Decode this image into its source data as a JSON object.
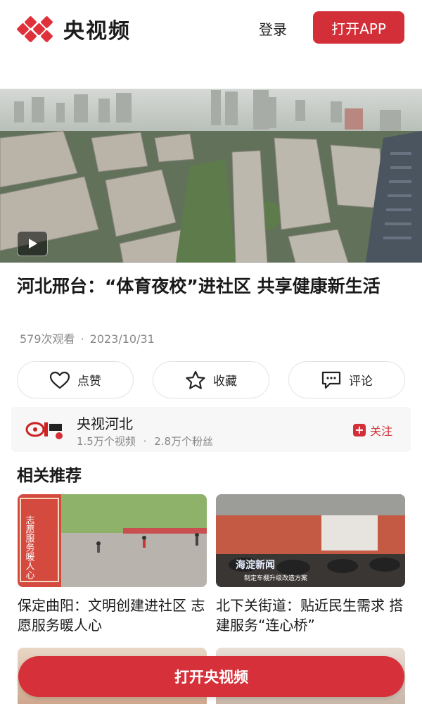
{
  "header": {
    "logo_text": "央视频",
    "login_label": "登录",
    "open_app_label": "打开APP",
    "brand_color": "#d32f38"
  },
  "video": {
    "play_icon": "play-icon"
  },
  "article": {
    "title": "河北邢台：“体育夜校”进社区 共享健康新生活",
    "views": "579次观看",
    "separator": "·",
    "date": "2023/10/31"
  },
  "actions": {
    "like_label": "点赞",
    "favorite_label": "收藏",
    "comment_label": "评论"
  },
  "channel": {
    "name": "央视河北",
    "videos": "1.5万个视频",
    "separator": "·",
    "fans": "2.8万个粉丝",
    "follow_label": "关注"
  },
  "related": {
    "heading": "相关推荐",
    "items": [
      {
        "title": "保定曲阳：文明创建进社区 志愿服务暖人心",
        "banner_text": "志愿服务暖人心"
      },
      {
        "title": "北下关街道：贴近民生需求 搭建服务“连心桥”",
        "overlay_title": "海淀新闻",
        "overlay_sub": "制定车棚升级改造方案"
      }
    ]
  },
  "cta": {
    "label": "打开央视频"
  }
}
